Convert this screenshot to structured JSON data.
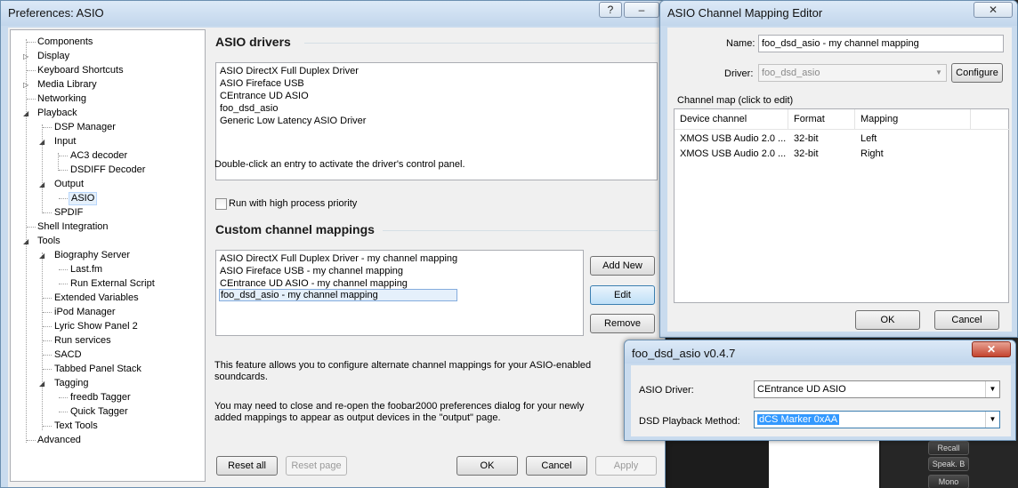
{
  "preferences": {
    "title": "Preferences: ASIO",
    "help_btn": "?",
    "min_btn": "–",
    "close_btn": "✕",
    "tree": [
      {
        "label": "Components"
      },
      {
        "label": "Display"
      },
      {
        "label": "Keyboard Shortcuts"
      },
      {
        "label": "Media Library"
      },
      {
        "label": "Networking"
      },
      {
        "label": "Playback"
      },
      {
        "label": "DSP Manager"
      },
      {
        "label": "Input"
      },
      {
        "label": "AC3 decoder"
      },
      {
        "label": "DSDIFF Decoder"
      },
      {
        "label": "Output"
      },
      {
        "label": "ASIO"
      },
      {
        "label": "SPDIF"
      },
      {
        "label": "Shell Integration"
      },
      {
        "label": "Tools"
      },
      {
        "label": "Biography Server"
      },
      {
        "label": "Last.fm"
      },
      {
        "label": "Run External Script"
      },
      {
        "label": "Extended Variables"
      },
      {
        "label": "iPod Manager"
      },
      {
        "label": "Lyric Show Panel 2"
      },
      {
        "label": "Run services"
      },
      {
        "label": "SACD"
      },
      {
        "label": "Tabbed Panel Stack"
      },
      {
        "label": "Tagging"
      },
      {
        "label": "freedb Tagger"
      },
      {
        "label": "Quick Tagger"
      },
      {
        "label": "Text Tools"
      },
      {
        "label": "Advanced"
      }
    ],
    "drivers_title": "ASIO drivers",
    "drivers": [
      "ASIO DirectX Full Duplex Driver",
      "ASIO Fireface USB",
      "CEntrance UD ASIO",
      "foo_dsd_asio",
      "Generic Low Latency ASIO Driver"
    ],
    "drivers_hint": "Double-click an entry to activate the driver's control panel.",
    "high_priority_label": "Run with high process priority",
    "mappings_title": "Custom channel mappings",
    "mappings": [
      "ASIO DirectX Full Duplex Driver - my channel mapping",
      "ASIO Fireface USB - my channel mapping",
      "CEntrance UD ASIO - my channel mapping",
      "foo_dsd_asio - my channel mapping"
    ],
    "add_new": "Add New",
    "edit": "Edit",
    "remove": "Remove",
    "info1_line1": "This feature allows you to configure alternate channel mappings for your ASIO-enabled",
    "info1_line2": "soundcards.",
    "info2_line1": "You may need to close and re-open the foobar2000 preferences dialog for your newly",
    "info2_line2": "added mappings to appear as output devices in the \"output\" page.",
    "reset_all": "Reset all",
    "reset_page": "Reset page",
    "ok": "OK",
    "cancel": "Cancel",
    "apply": "Apply"
  },
  "mapping_editor": {
    "title": "ASIO Channel Mapping Editor",
    "close_btn": "✕",
    "name_label": "Name:",
    "name_value": "foo_dsd_asio - my channel mapping",
    "driver_label": "Driver:",
    "driver_value": "foo_dsd_asio",
    "configure": "Configure",
    "channel_map_label": "Channel map (click to edit)",
    "columns": [
      "Device channel",
      "Format",
      "Mapping"
    ],
    "rows": [
      {
        "device": "XMOS USB Audio 2.0 ...",
        "format": "32-bit",
        "mapping": "Left"
      },
      {
        "device": "XMOS USB Audio 2.0 ...",
        "format": "32-bit",
        "mapping": "Right"
      }
    ],
    "ok": "OK",
    "cancel": "Cancel"
  },
  "dsd_dialog": {
    "title": "foo_dsd_asio v0.4.7",
    "close_btn": "✕",
    "asio_driver_label": "ASIO Driver:",
    "asio_driver_value": "CEntrance UD ASIO",
    "dsd_method_label": "DSD Playback Method:",
    "dsd_method_value": "dCS Marker 0xAA"
  },
  "background": {
    "button1": "Recall",
    "button2": "Speak. B",
    "button3": "Mono"
  }
}
